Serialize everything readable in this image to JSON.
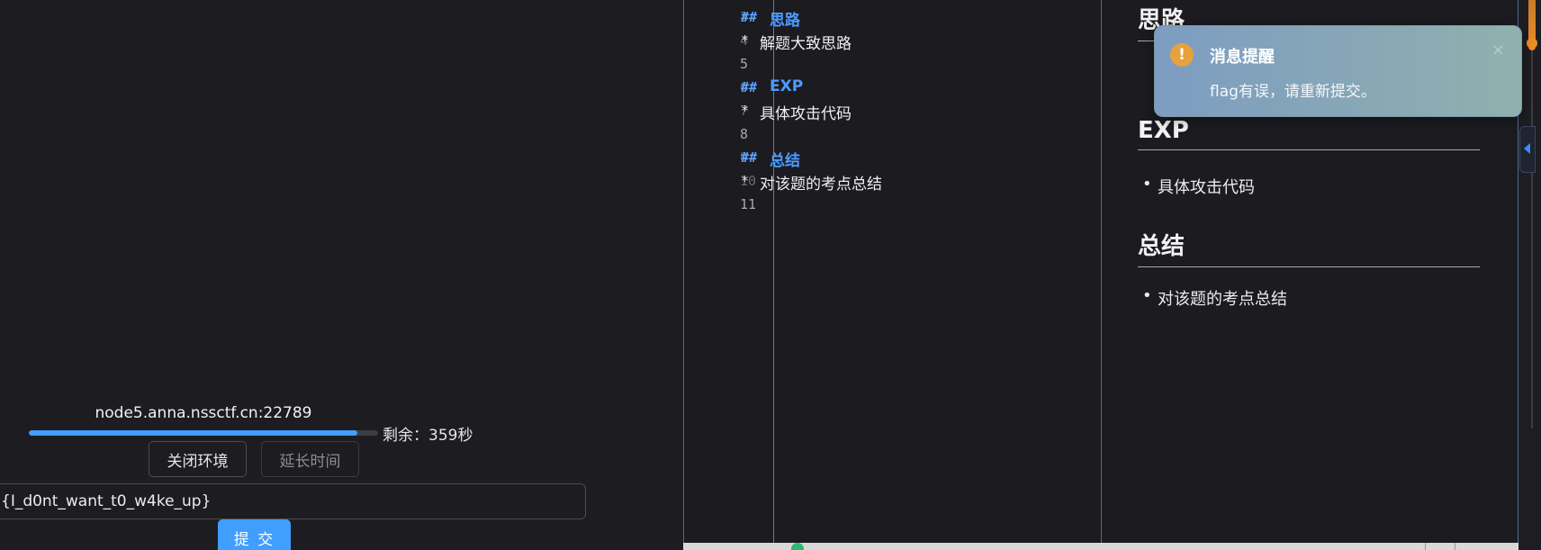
{
  "challenge": {
    "host": "node5.anna.nssctf.cn:22789",
    "remaining_text": "剩余：359秒",
    "progress": 0.94,
    "close_env_label": "关闭环境",
    "extend_time_label": "延长时间",
    "flag_value": "{I_d0nt_want_t0_w4ke_up}",
    "submit_label": "提 交"
  },
  "editor": {
    "lines": [
      {
        "num": "3",
        "marker": "##",
        "text": "思路",
        "kind": "heading"
      },
      {
        "num": "4",
        "marker": "*",
        "text": "解题大致思路",
        "kind": "bullet"
      },
      {
        "num": "5",
        "marker": "",
        "text": "",
        "kind": "blank"
      },
      {
        "num": "6",
        "marker": "##",
        "text": "EXP",
        "kind": "heading"
      },
      {
        "num": "7",
        "marker": "*",
        "text": "具体攻击代码",
        "kind": "bullet"
      },
      {
        "num": "8",
        "marker": "",
        "text": "",
        "kind": "blank"
      },
      {
        "num": "9",
        "marker": "##",
        "text": "总结",
        "kind": "heading"
      },
      {
        "num": "10",
        "marker": "*",
        "text": "对该题的考点总结",
        "kind": "bullet"
      },
      {
        "num": "11",
        "marker": "",
        "text": "",
        "kind": "blank"
      }
    ]
  },
  "preview": {
    "h_thinking": "思路",
    "h_exp": "EXP",
    "li_exp": "具体攻击代码",
    "h_summary": "总结",
    "li_summary": "对该题的考点总结"
  },
  "toast": {
    "title": "消息提醒",
    "message": "flag有误，请重新提交。",
    "icon": "warning-icon",
    "close": "×"
  },
  "colors": {
    "accent": "#409eff",
    "heading_blue": "#4c9bff",
    "warning": "#e6a23c",
    "scroll_orange": "#f08d24"
  }
}
